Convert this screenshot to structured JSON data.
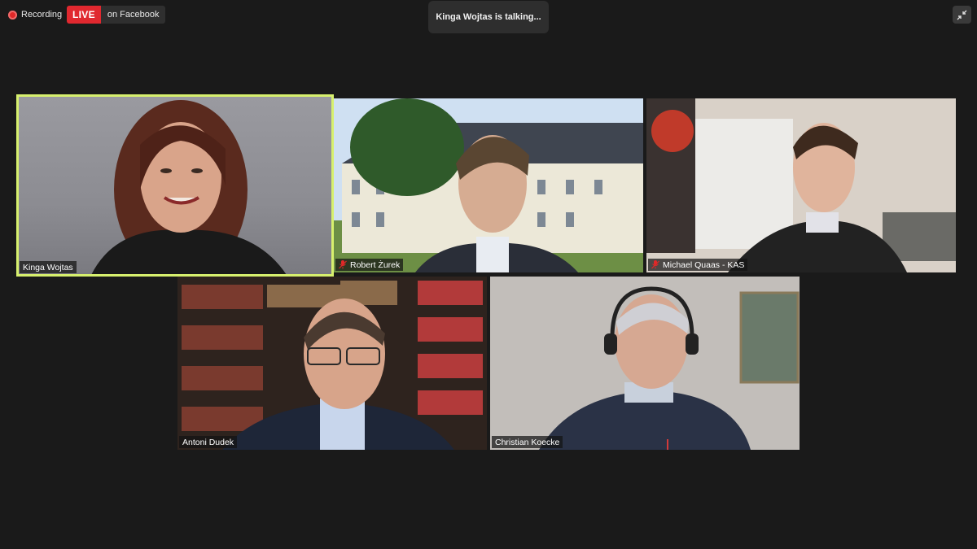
{
  "top_bar": {
    "recording_label": "Recording",
    "live_label": "LIVE",
    "live_target": "on Facebook",
    "talking_indicator": "Kinga Wojtas is talking...",
    "exit_fullscreen_icon": "exit-fullscreen-icon"
  },
  "participants": [
    {
      "name": "Kinga Wojtas",
      "muted": false,
      "active_speaker": true
    },
    {
      "name": "Robert Żurek",
      "muted": true,
      "active_speaker": false
    },
    {
      "name": "Michael Quaas - KAS",
      "muted": true,
      "active_speaker": false
    },
    {
      "name": "Antoni Dudek",
      "muted": false,
      "active_speaker": false
    },
    {
      "name": "Christian Koecke",
      "muted": false,
      "active_speaker": false
    }
  ],
  "colors": {
    "background": "#1a1a1a",
    "active_speaker_border": "#d7f06e",
    "live_badge": "#e0282f",
    "muted_mic": "#e02828"
  }
}
